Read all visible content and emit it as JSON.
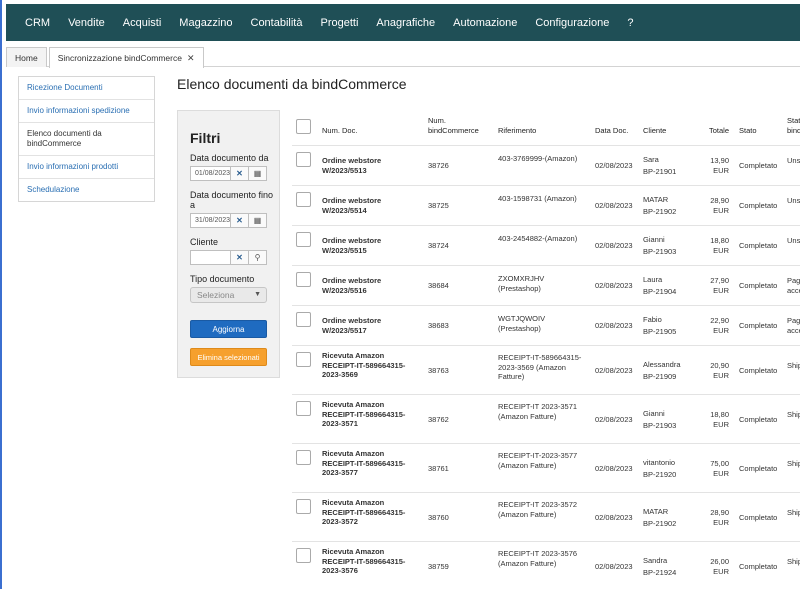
{
  "nav": {
    "items": [
      "CRM",
      "Vendite",
      "Acquisti",
      "Magazzino",
      "Contabilità",
      "Progetti",
      "Anagrafiche",
      "Automazione",
      "Configurazione",
      "?"
    ]
  },
  "tabs": {
    "home": "Home",
    "active": "Sincronizzazione bindCommerce",
    "close": "✕"
  },
  "sidebar": {
    "items": [
      "Ricezione Documenti",
      "Invio informazioni spedizione",
      "Elenco documenti da bindCommerce",
      "Invio informazioni prodotti",
      "Schedulazione"
    ]
  },
  "page": {
    "title": "Elenco documenti da bindCommerce"
  },
  "filters": {
    "title": "Filtri",
    "date_from_label": "Data documento da",
    "date_from_value": "01/08/2023",
    "date_to_label": "Data documento fino a",
    "date_to_value": "31/08/2023",
    "customer_label": "Cliente",
    "customer_value": "",
    "type_label": "Tipo documento",
    "type_placeholder": "Seleziona",
    "refresh": "Aggiorna",
    "delete_selected": "Elimina selezionati"
  },
  "table": {
    "headers": {
      "num_doc": "Num. Doc.",
      "num_bind": "Num. bindCommerce",
      "ref": "Riferimento",
      "date": "Data Doc.",
      "customer": "Cliente",
      "total": "Totale",
      "status": "Stato",
      "status_bind": "Stato bindC"
    },
    "rows": [
      {
        "doc": "Ordine webstore W/2023/5513",
        "bind": "38726",
        "ref": "403-3769999-(Amazon)",
        "date": "02/08/2023",
        "name": "Sara",
        "code": "BP-21901",
        "total": "13,90 EUR",
        "status": "Completato",
        "bstatus": "Unsh"
      },
      {
        "doc": "Ordine webstore W/2023/5514",
        "bind": "38725",
        "ref": "403-1598731 (Amazon)",
        "date": "02/08/2023",
        "name": "MATAR",
        "code": "BP-21902",
        "total": "28,90 EUR",
        "status": "Completato",
        "bstatus": "Unsh"
      },
      {
        "doc": "Ordine webstore W/2023/5515",
        "bind": "38724",
        "ref": "403-2454882-(Amazon)",
        "date": "02/08/2023",
        "name": "Gianni",
        "code": "BP-21903",
        "total": "18,80 EUR",
        "status": "Completato",
        "bstatus": "Unsh"
      },
      {
        "doc": "Ordine webstore W/2023/5516",
        "bind": "38684",
        "ref": "ZXOMXRJHV (Prestashop)",
        "date": "02/08/2023",
        "name": "Laura",
        "code": "BP-21904",
        "total": "27,90 EUR",
        "status": "Completato",
        "bstatus": "Paga acce"
      },
      {
        "doc": "Ordine webstore W/2023/5517",
        "bind": "38683",
        "ref": "WGTJQWOIV (Prestashop)",
        "date": "02/08/2023",
        "name": "Fabio",
        "code": "BP-21905",
        "total": "22,90 EUR",
        "status": "Completato",
        "bstatus": "Paga acce"
      },
      {
        "doc": "Ricevuta Amazon RECEIPT-IT-589664315-2023-3569",
        "bind": "38763",
        "ref": "RECEIPT-IT-589664315-2023-3569 (Amazon Fatture)",
        "date": "02/08/2023",
        "name": "Alessandra",
        "code": "BP-21909",
        "total": "20,90 EUR",
        "status": "Completato",
        "bstatus": "Ship"
      },
      {
        "doc": "Ricevuta Amazon RECEIPT-IT-589664315-2023-3571",
        "bind": "38762",
        "ref": "RECEIPT-IT 2023-3571 (Amazon Fatture)",
        "date": "02/08/2023",
        "name": "Gianni",
        "code": "BP-21903",
        "total": "18,80 EUR",
        "status": "Completato",
        "bstatus": "Ship"
      },
      {
        "doc": "Ricevuta Amazon RECEIPT-IT-589664315-2023-3577",
        "bind": "38761",
        "ref": "RECEIPT-IT-2023-3577 (Amazon Fatture)",
        "date": "02/08/2023",
        "name": "vitantonio",
        "code": "BP-21920",
        "total": "75,00 EUR",
        "status": "Completato",
        "bstatus": "Ship"
      },
      {
        "doc": "Ricevuta Amazon RECEIPT-IT-589664315-2023-3572",
        "bind": "38760",
        "ref": "RECEIPT-IT 2023-3572 (Amazon Fatture)",
        "date": "02/08/2023",
        "name": "MATAR",
        "code": "BP-21902",
        "total": "28,90 EUR",
        "status": "Completato",
        "bstatus": "Ship"
      },
      {
        "doc": "Ricevuta Amazon RECEIPT-IT-589664315-2023-3576",
        "bind": "38759",
        "ref": "RECEIPT-IT 2023-3576 (Amazon Fatture)",
        "date": "02/08/2023",
        "name": "Sandra",
        "code": "BP-21924",
        "total": "26,00 EUR",
        "status": "Completato",
        "bstatus": "Ship"
      }
    ]
  },
  "colors": {
    "nav_bg": "#1f4f56",
    "link": "#1e6fc1",
    "primary_button": "#1f6bc0",
    "warning_button": "#f6a02d"
  }
}
